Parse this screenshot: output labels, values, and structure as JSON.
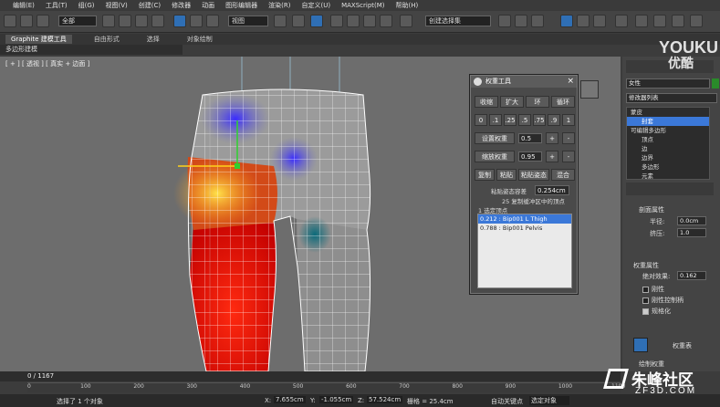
{
  "menubar": {
    "items": [
      "编辑(E)",
      "工具(T)",
      "组(G)",
      "视图(V)",
      "创建(C)",
      "修改器",
      "动画",
      "图形编辑器",
      "渲染(R)",
      "自定义(U)",
      "MAXScript(M)",
      "帮助(H)"
    ]
  },
  "toolbar": {
    "selection_filter": "全部",
    "ref_coord": "视图",
    "named_selection": "创建选择集"
  },
  "ribbon": {
    "tabs": [
      "Graphite 建模工具",
      "自由形式",
      "选择",
      "对象绘制"
    ],
    "sub_label": "多边形建模"
  },
  "viewport": {
    "label": "[ + ] [ 透视 ] [ 真实 + 边面 ]"
  },
  "weight_tool": {
    "title": "权重工具",
    "row1": [
      "收缩",
      "扩大",
      "环",
      "循环"
    ],
    "presets": [
      "0",
      ".1",
      ".25",
      ".5",
      ".75",
      ".9",
      "1"
    ],
    "set_weight_label": "设置权重",
    "set_weight_value": "0.5",
    "scale_weight_label": "缩放权重",
    "scale_weight_value": "0.95",
    "plus": "+",
    "minus": "-",
    "row_copy": [
      "复制",
      "粘贴",
      "粘贴姿态",
      "混合"
    ],
    "tolerance_label": "粘贴姿态容差",
    "tolerance_value": "0.254cm",
    "info1": "25 复制缓冲区中的顶点",
    "info2": "1 选定顶点",
    "list": [
      "0.212 : Bip001 L Thigh",
      "0.788 : Bip001 Pelvis"
    ],
    "selected_index": 0
  },
  "command_panel": {
    "object_name": "女性",
    "modifier_list_label": "修改器列表",
    "stack": [
      {
        "label": "蒙皮",
        "indent": 0,
        "selected": false
      },
      {
        "label": "封套",
        "indent": 1,
        "selected": true
      },
      {
        "label": "可编辑多边形",
        "indent": 0,
        "selected": false
      },
      {
        "label": "顶点",
        "indent": 1,
        "selected": false
      },
      {
        "label": "边",
        "indent": 1,
        "selected": false
      },
      {
        "label": "边界",
        "indent": 1,
        "selected": false
      },
      {
        "label": "多边形",
        "indent": 1,
        "selected": false
      },
      {
        "label": "元素",
        "indent": 1,
        "selected": false
      }
    ],
    "section_cross": "剖面属性",
    "radius_label": "半径:",
    "radius_value": "0.0cm",
    "squash_label": "挤压:",
    "squash_value": "1.0",
    "weight_section": "权重属性",
    "abs_effect_label": "绝对效果:",
    "abs_effect_value": "0.162",
    "check_rigid": "刚性",
    "check_rigid_handles": "刚性控制柄",
    "check_normalize": "规格化",
    "weight_table_label": "权重表",
    "paint_weight_label": "绘制权重"
  },
  "timeline": {
    "frame": "0 / 1167",
    "ticks": [
      "0",
      "100",
      "200",
      "300",
      "400",
      "500",
      "600",
      "700",
      "800",
      "900",
      "1000",
      "1100"
    ]
  },
  "statusbar": {
    "selection": "选择了 1 个对象",
    "x_label": "X:",
    "x_value": "7.655cm",
    "y_label": "Y:",
    "y_value": "-1.055cm",
    "z_label": "Z:",
    "z_value": "57.524cm",
    "grid": "栅格 = 25.4cm",
    "autokey": "自动关键点",
    "selected_obj": "选定对象"
  },
  "watermarks": {
    "youku": "YOUKU",
    "youku_cn": "优酷",
    "zf_cn": "朱峰社区",
    "zf_url": "ZF3D.COM"
  }
}
